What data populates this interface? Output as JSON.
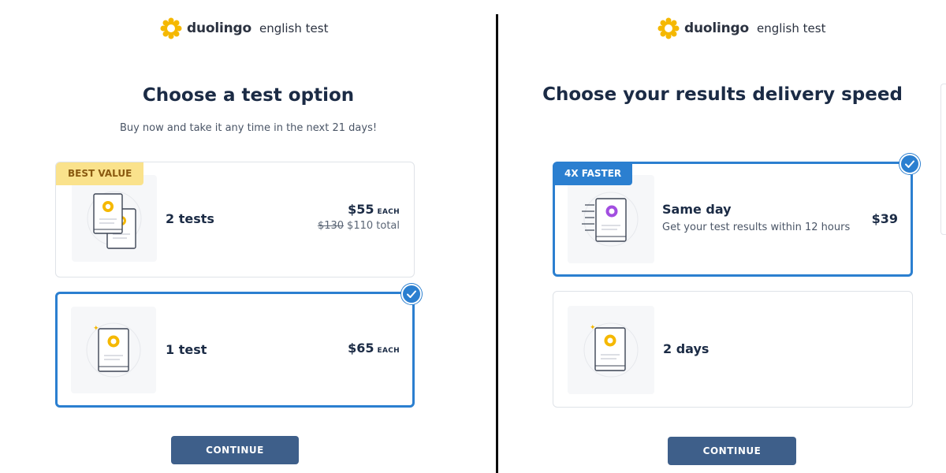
{
  "brand": {
    "name": "duolingo",
    "sub": "english test",
    "accent": "#f5b800"
  },
  "left": {
    "title": "Choose a test option",
    "subtitle": "Buy now and take it any time in the next 21 days!",
    "options": [
      {
        "badge": "BEST VALUE",
        "label": "2 tests",
        "price": "$55",
        "unit": "EACH",
        "original": "$130",
        "total": "$110 total",
        "selected": false
      },
      {
        "label": "1 test",
        "price": "$65",
        "unit": "EACH",
        "selected": true
      }
    ],
    "continue_label": "CONTINUE"
  },
  "right": {
    "title": "Choose your results delivery speed",
    "options": [
      {
        "badge": "4X FASTER",
        "label": "Same day",
        "desc": "Get your test results within 12 hours",
        "price": "$39",
        "selected": true
      },
      {
        "label": "2 days",
        "selected": false
      }
    ],
    "continue_label": "CONTINUE"
  },
  "colors": {
    "selected_border": "#2b7fd0",
    "button_bg": "#3e5f8a",
    "best_value_bg": "#fae28c",
    "faster_bg": "#2b7fd0"
  },
  "icons": [
    "duolingo-logo-icon",
    "checkmark-icon",
    "test-booklet-icon",
    "fast-delivery-icon"
  ]
}
